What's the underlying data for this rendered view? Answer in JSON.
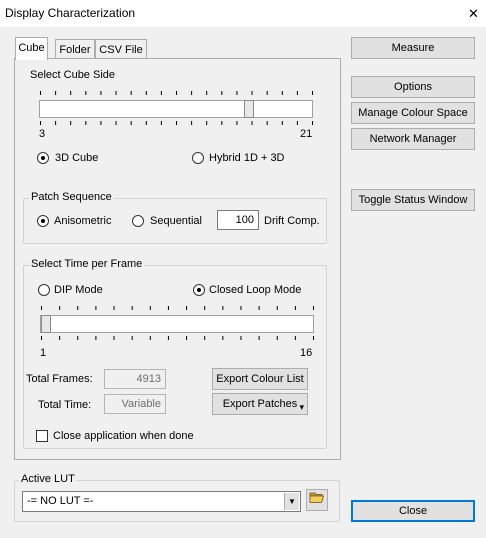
{
  "window": {
    "title": "Display Characterization",
    "close_glyph": "✕"
  },
  "tabs": [
    {
      "label": "Cube",
      "active": true
    },
    {
      "label": "Folder",
      "active": false
    },
    {
      "label": "CSV File",
      "active": false
    }
  ],
  "cube_side": {
    "heading": "Select Cube Side",
    "slider": {
      "min_label": "3",
      "max_label": "21",
      "level_fraction": 0.78
    },
    "options": [
      {
        "label": "3D Cube",
        "checked": true
      },
      {
        "label": "Hybrid 1D + 3D",
        "checked": false
      }
    ]
  },
  "patch_sequence": {
    "legend": "Patch Sequence",
    "options": [
      {
        "label": "Anisometric",
        "checked": true
      },
      {
        "label": "Sequential",
        "checked": false
      }
    ],
    "drift_value": "100",
    "drift_label": "Drift Comp."
  },
  "time_per_frame": {
    "legend": "Select Time per Frame",
    "options": [
      {
        "label": "DIP Mode",
        "checked": false
      },
      {
        "label": "Closed Loop Mode",
        "checked": true
      }
    ],
    "slider": {
      "min_label": "1",
      "max_label": "16",
      "level_fraction": 0.0
    },
    "total_frames_label": "Total Frames:",
    "total_frames_value": "4913",
    "total_time_label": "Total Time:",
    "total_time_value": "Variable",
    "export_colour_list": "Export Colour List",
    "export_patches": "Export Patches",
    "export_patches_arrow": "▾"
  },
  "close_when_done": {
    "label": "Close application when done",
    "checked": false
  },
  "active_lut": {
    "legend": "Active LUT",
    "value": "-= NO LUT =-",
    "open_icon": "folder-open-icon"
  },
  "side_buttons": {
    "measure": "Measure",
    "options": "Options",
    "manage_colour_space": "Manage Colour Space",
    "network_manager": "Network Manager",
    "toggle_status_window": "Toggle Status Window",
    "close": "Close"
  },
  "colors": {
    "background": "#f0f0f0",
    "button_face": "#e1e1e1",
    "focus_border": "#0078d7"
  }
}
